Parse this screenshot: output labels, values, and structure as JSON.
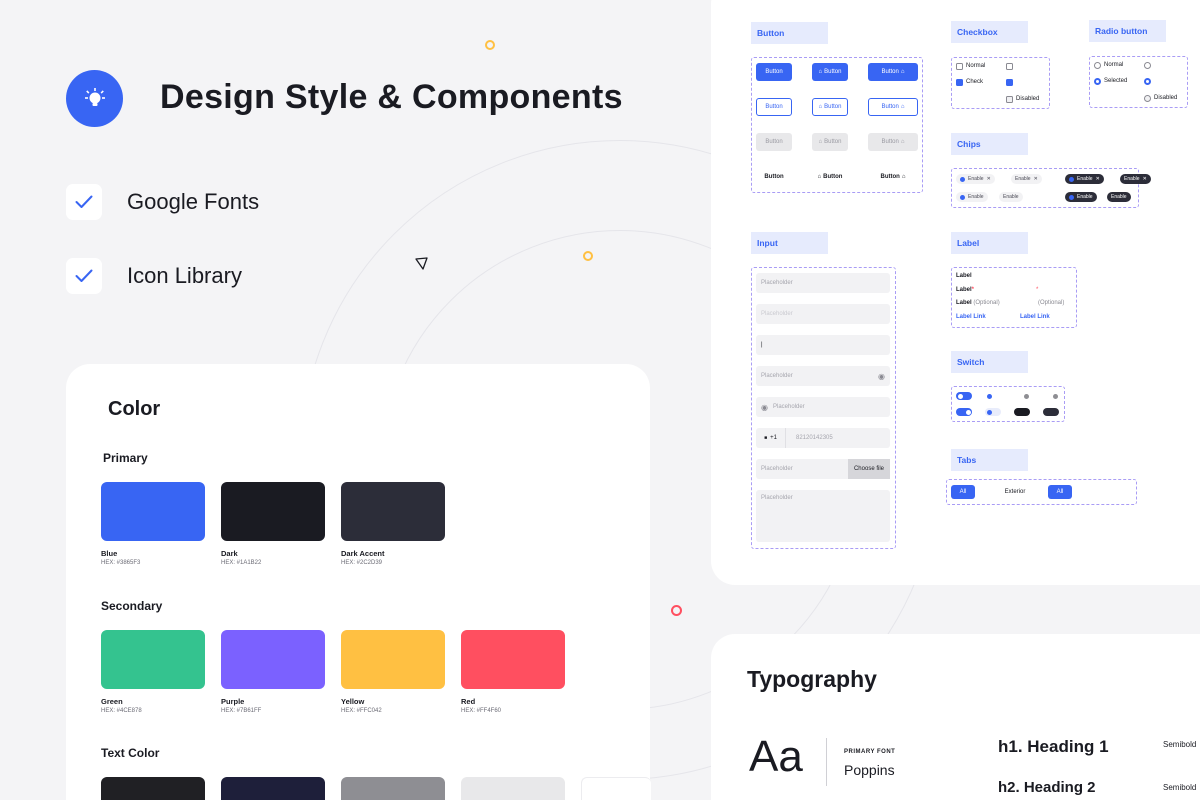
{
  "header": {
    "title": "Design Style & Components",
    "logo_icon": "lightbulb-icon",
    "features": [
      {
        "label": "Google Fonts",
        "icon": "check-icon"
      },
      {
        "label": "Icon Library",
        "icon": "check-icon"
      }
    ]
  },
  "colors": {
    "accent": "#3865F3",
    "title": "Color",
    "primary": {
      "label": "Primary",
      "swatches": [
        {
          "name": "Blue",
          "hex": "HEX: #3865F3",
          "color": "#3865F3"
        },
        {
          "name": "Dark",
          "hex": "HEX: #1A1B22",
          "color": "#1A1B22"
        },
        {
          "name": "Dark Accent",
          "hex": "HEX: #2C2D39",
          "color": "#2C2D39"
        }
      ]
    },
    "secondary": {
      "label": "Secondary",
      "swatches": [
        {
          "name": "Green",
          "hex": "HEX: #4CE878",
          "color": "#34C38F"
        },
        {
          "name": "Purple",
          "hex": "HEX: #7B61FF",
          "color": "#7B61FF"
        },
        {
          "name": "Yellow",
          "hex": "HEX: #FFC042",
          "color": "#FFC042"
        },
        {
          "name": "Red",
          "hex": "HEX: #FF4F60",
          "color": "#FF4F60"
        }
      ]
    },
    "text": {
      "label": "Text Color",
      "swatches": [
        {
          "color": "#202024"
        },
        {
          "color": "#1E1F3A"
        },
        {
          "color": "#8E8E93"
        },
        {
          "color": "#E8E8EA"
        }
      ]
    }
  },
  "components": {
    "button": {
      "tag": "Button",
      "label": "Button"
    },
    "checkbox": {
      "tag": "Checkbox",
      "normal": "Normal",
      "check": "Check",
      "disabled": "Disabled"
    },
    "radio": {
      "tag": "Radio button",
      "normal": "Normal",
      "selected": "Selected",
      "disabled": "Disabled"
    },
    "chips": {
      "tag": "Chips",
      "label": "Enable"
    },
    "input": {
      "tag": "Input",
      "placeholder": "Placeholder",
      "cursor": "|",
      "country_code": "+1",
      "phone": "82120142305",
      "choose_file": "Choose file"
    },
    "label": {
      "tag": "Label",
      "label": "Label",
      "required": "*",
      "optional": "(Optional)",
      "link": "Label Link"
    },
    "switch": {
      "tag": "Switch"
    },
    "tabs": {
      "tag": "Tabs",
      "items": [
        "All",
        "Exterior",
        "All"
      ]
    }
  },
  "typography": {
    "title": "Typography",
    "sample": "Aa",
    "font_label": "PRIMARY FONT",
    "font_name": "Poppins",
    "headings": [
      {
        "text": "h1. Heading 1",
        "weight": "Semibold"
      },
      {
        "text": "h2. Heading 2",
        "weight": "Semibold"
      }
    ]
  }
}
